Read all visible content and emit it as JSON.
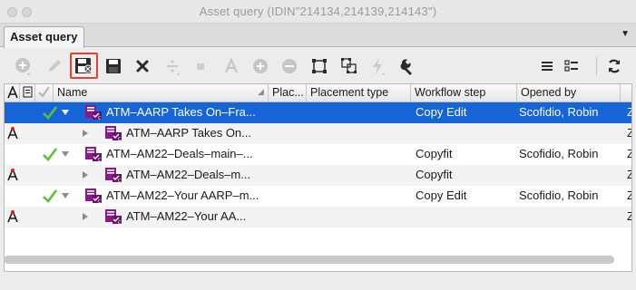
{
  "window": {
    "title": "Asset query (IDIN\"214134,214139,214143\")"
  },
  "tab": {
    "label": "Asset query",
    "menu_icon": "triangle-down-icon"
  },
  "toolbar": {
    "buttons": [
      {
        "name": "add-icon",
        "enabled": false
      },
      {
        "name": "edit-pencil-icon",
        "enabled": false
      },
      {
        "name": "save-as-icon",
        "enabled": true,
        "highlighted": true
      },
      {
        "name": "save-icon",
        "enabled": true
      },
      {
        "name": "delete-x-icon",
        "enabled": true
      },
      {
        "name": "divide-icon",
        "enabled": false
      },
      {
        "name": "stop-square-icon",
        "enabled": false
      },
      {
        "name": "text-a-icon",
        "enabled": false
      },
      {
        "name": "plus-circle-icon",
        "enabled": false
      },
      {
        "name": "minus-circle-icon",
        "enabled": false
      },
      {
        "name": "frame-bounds-icon",
        "enabled": true
      },
      {
        "name": "multi-frame-icon",
        "enabled": true
      },
      {
        "name": "lightning-icon",
        "enabled": false
      },
      {
        "name": "wrench-icon",
        "enabled": true
      },
      {
        "name": "list-view-icon",
        "enabled": true
      },
      {
        "name": "detail-view-icon",
        "enabled": true
      },
      {
        "name": "refresh-icon",
        "enabled": true
      }
    ]
  },
  "table": {
    "columns": [
      "Name",
      "Plac...",
      "Placement type",
      "Workflow step",
      "Opened by"
    ],
    "header_icons": [
      "lock-a-icon",
      "document-icon",
      "checkmark-icon"
    ],
    "rows": [
      {
        "name": "ATM–AARP Takes On–Fra...",
        "workflow": "Copy Edit",
        "opened_by": "Scofidio, Robin",
        "edge": "Z",
        "level": 0,
        "expanded": true,
        "checked": true,
        "locked": false,
        "selected": true
      },
      {
        "name": "ATM–AARP Takes On...",
        "workflow": "",
        "opened_by": "",
        "edge": "Z",
        "level": 1,
        "expanded": false,
        "checked": false,
        "locked": true,
        "selected": false
      },
      {
        "name": "ATM–AM22–Deals–main–...",
        "workflow": "Copyfit",
        "opened_by": "Scofidio, Robin",
        "edge": "Z",
        "level": 0,
        "expanded": true,
        "checked": true,
        "locked": false,
        "selected": false
      },
      {
        "name": "ATM–AM22–Deals–m...",
        "workflow": "Copyfit",
        "opened_by": "",
        "edge": "Z",
        "level": 1,
        "expanded": false,
        "checked": false,
        "locked": true,
        "selected": false
      },
      {
        "name": "ATM–AM22–Your AARP–m...",
        "workflow": "Copy Edit",
        "opened_by": "Scofidio, Robin",
        "edge": "Z",
        "level": 0,
        "expanded": true,
        "checked": true,
        "locked": false,
        "selected": false
      },
      {
        "name": "ATM–AM22–Your AA...",
        "workflow": "",
        "opened_by": "",
        "edge": "Z",
        "level": 1,
        "expanded": false,
        "checked": false,
        "locked": true,
        "selected": false
      }
    ]
  },
  "colors": {
    "selection": "#1565d6",
    "highlight_box": "#e2452f",
    "checkmark": "#5fbf36",
    "doc_icon": "#8a1a8a"
  }
}
